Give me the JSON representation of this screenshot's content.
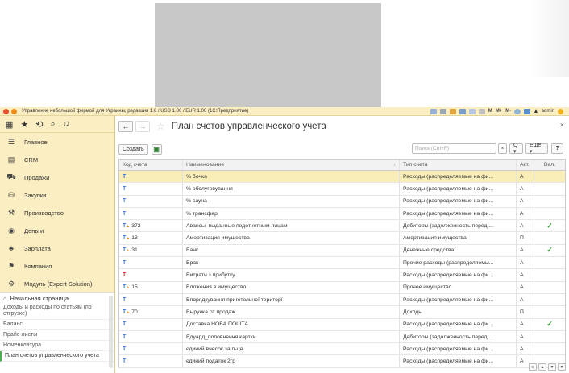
{
  "window": {
    "title": "Управление небольшой фирмой для Украины, редакция 1.6 / USD 1.00 / EUR 1.00  (1С:Предприятие)",
    "menu_m1": "M",
    "menu_m2": "M+",
    "menu_m3": "M-",
    "user": "admin",
    "accent": "#fbeec2"
  },
  "sidebar": {
    "sections": [
      {
        "label": "Главное",
        "icon": "menu-lines-icon"
      },
      {
        "label": "CRM",
        "icon": "crm-icon"
      },
      {
        "label": "Продажи",
        "icon": "sales-icon"
      },
      {
        "label": "Закупки",
        "icon": "purchases-icon"
      },
      {
        "label": "Производство",
        "icon": "production-icon"
      },
      {
        "label": "Деньги",
        "icon": "money-icon"
      },
      {
        "label": "Зарплата",
        "icon": "salary-icon"
      },
      {
        "label": "Компания",
        "icon": "company-icon"
      },
      {
        "label": "Модуль (Expert Solution)",
        "icon": "module-icon"
      }
    ],
    "home": "Начальная страница",
    "links": [
      "Доходы и расходы по статьям (по отгрузке)",
      "Баланс",
      "Прайс-листы",
      "Номенклатура",
      "План счетов управленческого учета"
    ]
  },
  "main": {
    "title": "План счетов управленческого учета",
    "create_label": "Создать",
    "search_placeholder": "Поиск (Ctrl+F)",
    "search_clear": "×",
    "search_go": "Q ▾",
    "more_label": "Еще ▾",
    "help_label": "?",
    "close": "×"
  },
  "table": {
    "headers": {
      "code": "Код счета",
      "name": "Наименование",
      "type": "Тип счета",
      "act": "Акт.",
      "val": "Вал."
    },
    "rows": [
      {
        "code": "",
        "name": "% бочка",
        "type": "Расходы (распределяемые на фи...",
        "act": "А",
        "val": ""
      },
      {
        "code": "",
        "name": "% обслуговування",
        "type": "Расходы (распределяемые на фи...",
        "act": "А",
        "val": ""
      },
      {
        "code": "",
        "name": "% сауна",
        "type": "Расходы (распределяемые на фи...",
        "act": "А",
        "val": ""
      },
      {
        "code": "",
        "name": "% трансфер",
        "type": "Расходы (распределяемые на фи...",
        "act": "А",
        "val": ""
      },
      {
        "code": "372",
        "name": "Авансы, выданные подотчетным лицам",
        "type": "Дебиторы (задолженность перед ...",
        "act": "А",
        "val": "✓"
      },
      {
        "code": "13",
        "name": "Амортизация имущества",
        "type": "Амортизация имущества",
        "act": "П",
        "val": ""
      },
      {
        "code": "31",
        "name": "Банк",
        "type": "Денежные средства",
        "act": "А",
        "val": "✓"
      },
      {
        "code": "",
        "name": "Брак",
        "type": "Прочие расходы (распределяемы...",
        "act": "А",
        "val": ""
      },
      {
        "code": "",
        "name": "Витрати з прибутку",
        "type": "Расходы (распределяемые на фи...",
        "act": "А",
        "val": ""
      },
      {
        "code": "15",
        "name": "Вложения в имущество",
        "type": "Прочее имущество",
        "act": "А",
        "val": ""
      },
      {
        "code": "",
        "name": "Впорядкування пригетельної територї",
        "type": "Расходы (распределяемые на фи...",
        "act": "А",
        "val": ""
      },
      {
        "code": "70",
        "name": "Выручка от продаж",
        "type": "Доходы",
        "act": "П",
        "val": ""
      },
      {
        "code": "",
        "name": "Доставка НОВА ПОШТА",
        "type": "Расходы (распределяемые на фи...",
        "act": "А",
        "val": "✓"
      },
      {
        "code": "",
        "name": "Едуард_поповнення картки",
        "type": "Дебиторы (задолженность перед ...",
        "act": "А",
        "val": ""
      },
      {
        "code": "",
        "name": "єдиний внесок за п-ця",
        "type": "Расходы (распределяемые на фи...",
        "act": "А",
        "val": ""
      },
      {
        "code": "",
        "name": "єдиний податок 2гр",
        "type": "Расходы (распределяемые на фи...",
        "act": "А",
        "val": ""
      }
    ]
  }
}
